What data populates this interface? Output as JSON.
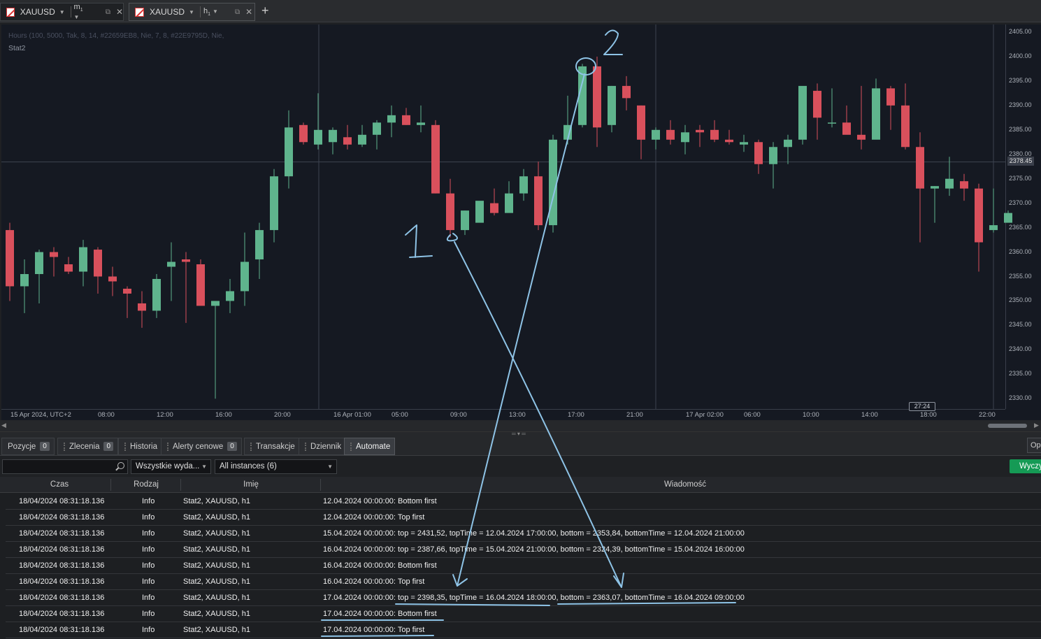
{
  "tabs": [
    {
      "symbol": "XAUUSD",
      "timeframe": "m",
      "timeframe_sub": "1"
    },
    {
      "symbol": "XAUUSD",
      "timeframe": "h",
      "timeframe_sub": "1"
    }
  ],
  "chart": {
    "indicator_params": "Hours (100, 5000, Tak, 8, 14, #22659EB8, Nie, 7, 8, #22E9795D, Nie,",
    "strategy_name": "Stat2",
    "current_price": "2378.45",
    "bar_timer": "27:24",
    "y_ticks": [
      "2405.00",
      "2400.00",
      "2395.00",
      "2390.00",
      "2385.00",
      "2380.00",
      "2375.00",
      "2370.00",
      "2365.00",
      "2360.00",
      "2355.00",
      "2350.00",
      "2345.00",
      "2340.00",
      "2335.00",
      "2330.00"
    ],
    "x_ticks": [
      "15 Apr 2024, UTC+2",
      "08:00",
      "12:00",
      "16:00",
      "20:00",
      "16 Apr 01:00",
      "05:00",
      "09:00",
      "13:00",
      "17:00",
      "21:00",
      "17 Apr 02:00",
      "06:00",
      "10:00",
      "14:00",
      "18:00",
      "22:00"
    ],
    "up_color": "#5fb48d",
    "down_color": "#d9505c",
    "annotation_color": "#8ec3e6",
    "annotation_labels": [
      "1",
      "2"
    ]
  },
  "chart_data": {
    "type": "candlestick",
    "symbol": "XAUUSD",
    "timeframe": "h1",
    "ylim": [
      2328,
      2406
    ],
    "candles": [
      [
        2364.5,
        2366.0,
        2350.0,
        2353.0
      ],
      [
        2353.0,
        2358.5,
        2347.5,
        2355.5
      ],
      [
        2355.5,
        2360.5,
        2349.5,
        2360.0
      ],
      [
        2360.0,
        2361.0,
        2355.0,
        2359.0
      ],
      [
        2357.5,
        2359.0,
        2355.5,
        2356.0
      ],
      [
        2356.0,
        2362.5,
        2353.0,
        2361.0
      ],
      [
        2360.5,
        2361.0,
        2351.5,
        2355.0
      ],
      [
        2355.0,
        2357.0,
        2351.0,
        2354.0
      ],
      [
        2352.5,
        2353.0,
        2346.5,
        2351.5
      ],
      [
        2349.5,
        2352.0,
        2344.5,
        2348.0
      ],
      [
        2348.0,
        2355.5,
        2346.5,
        2354.5
      ],
      [
        2357.0,
        2362.0,
        2350.0,
        2358.0
      ],
      [
        2358.5,
        2360.0,
        2345.5,
        2358.0
      ],
      [
        2357.5,
        2358.5,
        2350.5,
        2349.0
      ],
      [
        2349.0,
        2350.0,
        2330.0,
        2350.0
      ],
      [
        2350.0,
        2354.5,
        2347.5,
        2352.0
      ],
      [
        2352.0,
        2364.0,
        2349.0,
        2358.0
      ],
      [
        2358.5,
        2366.0,
        2354.5,
        2364.5
      ],
      [
        2364.5,
        2377.0,
        2362.0,
        2375.5
      ],
      [
        2375.5,
        2389.0,
        2373.0,
        2385.5
      ],
      [
        2386.0,
        2386.5,
        2382.0,
        2382.5
      ],
      [
        2382.0,
        2392.5,
        2381.0,
        2385.0
      ],
      [
        2382.5,
        2385.5,
        2380.0,
        2385.0
      ],
      [
        2383.5,
        2386.0,
        2381.0,
        2382.0
      ],
      [
        2382.0,
        2386.0,
        2381.5,
        2384.0
      ],
      [
        2384.0,
        2387.0,
        2381.0,
        2386.5
      ],
      [
        2386.5,
        2390.0,
        2383.5,
        2388.0
      ],
      [
        2388.0,
        2389.5,
        2386.0,
        2386.0
      ],
      [
        2386.0,
        2390.0,
        2384.5,
        2386.5
      ],
      [
        2386.0,
        2387.0,
        2372.0,
        2372.0
      ],
      [
        2372.0,
        2375.0,
        2363.0,
        2364.5
      ],
      [
        2364.5,
        2368.5,
        2363.5,
        2368.5
      ],
      [
        2366.0,
        2370.0,
        2367.5,
        2370.5
      ],
      [
        2370.0,
        2373.0,
        2367.5,
        2368.0
      ],
      [
        2368.0,
        2374.5,
        2368.5,
        2372.0
      ],
      [
        2372.0,
        2377.0,
        2370.5,
        2375.5
      ],
      [
        2375.5,
        2378.5,
        2364.5,
        2365.5
      ],
      [
        2365.5,
        2384.0,
        2364.0,
        2383.0
      ],
      [
        2383.0,
        2392.0,
        2382.0,
        2386.0
      ],
      [
        2386.0,
        2398.5,
        2385.5,
        2398.0
      ],
      [
        2398.0,
        2400.0,
        2381.5,
        2385.5
      ],
      [
        2386.0,
        2394.0,
        2384.5,
        2394.0
      ],
      [
        2394.0,
        2396.0,
        2389.0,
        2391.5
      ],
      [
        2390.0,
        2390.0,
        2379.0,
        2383.0
      ],
      [
        2383.0,
        2385.5,
        2381.0,
        2385.0
      ],
      [
        2385.0,
        2387.0,
        2382.0,
        2383.0
      ],
      [
        2382.5,
        2386.0,
        2380.0,
        2384.5
      ],
      [
        2385.0,
        2386.0,
        2381.5,
        2384.5
      ],
      [
        2385.0,
        2387.0,
        2382.5,
        2383.0
      ],
      [
        2383.0,
        2385.0,
        2382.0,
        2382.5
      ],
      [
        2382.0,
        2384.0,
        2380.5,
        2382.5
      ],
      [
        2382.5,
        2383.0,
        2376.0,
        2378.0
      ],
      [
        2378.0,
        2382.5,
        2373.0,
        2381.5
      ],
      [
        2381.5,
        2384.0,
        2378.0,
        2383.0
      ],
      [
        2383.0,
        2393.5,
        2382.0,
        2394.0
      ],
      [
        2393.0,
        2394.5,
        2383.0,
        2387.5
      ],
      [
        2386.5,
        2393.5,
        2385.5,
        2386.5
      ],
      [
        2386.5,
        2390.0,
        2385.0,
        2384.0
      ],
      [
        2384.0,
        2394.0,
        2381.0,
        2383.0
      ],
      [
        2383.0,
        2395.5,
        2383.5,
        2393.5
      ],
      [
        2393.5,
        2394.0,
        2385.0,
        2390.0
      ],
      [
        2390.0,
        2394.5,
        2381.0,
        2381.5
      ],
      [
        2381.5,
        2384.5,
        2362.0,
        2373.0
      ],
      [
        2373.0,
        2373.5,
        2366.0,
        2373.5
      ],
      [
        2373.0,
        2379.5,
        2371.5,
        2375.0
      ],
      [
        2374.5,
        2376.0,
        2370.5,
        2373.0
      ],
      [
        2373.0,
        2374.0,
        2356.0,
        2362.0
      ],
      [
        2364.5,
        2373.0,
        2364.0,
        2365.5
      ],
      [
        2366.0,
        2368.5,
        2367.0,
        2368.0
      ]
    ]
  },
  "panel": {
    "tabs": [
      {
        "label": "Pozycje",
        "badge": "0"
      },
      {
        "label": "Zlecenia",
        "badge": "0"
      },
      {
        "label": "Historia"
      },
      {
        "label": "Alerty cenowe",
        "badge": "0"
      },
      {
        "label": "Transakcje"
      },
      {
        "label": "Dziennik"
      },
      {
        "label": "Automate"
      }
    ],
    "options_label": "Op",
    "search_placeholder": "",
    "filter_events": "Wszystkie wyda...",
    "filter_instances": "All instances (6)",
    "clear_button": "Wyczy",
    "columns": [
      "Czas",
      "Rodzaj",
      "Imię",
      "Wiadomość"
    ],
    "rows": [
      {
        "time": "18/04/2024 08:31:18.136",
        "kind": "Info",
        "name": "Stat2, XAUUSD, h1",
        "message": "12.04.2024 00:00:00: Bottom first"
      },
      {
        "time": "18/04/2024 08:31:18.136",
        "kind": "Info",
        "name": "Stat2, XAUUSD, h1",
        "message": "12.04.2024 00:00:00: Top first"
      },
      {
        "time": "18/04/2024 08:31:18.136",
        "kind": "Info",
        "name": "Stat2, XAUUSD, h1",
        "message": "15.04.2024 00:00:00: top = 2431,52, topTime = 12.04.2024 17:00:00, bottom = 2353,84, bottomTime = 12.04.2024 21:00:00"
      },
      {
        "time": "18/04/2024 08:31:18.136",
        "kind": "Info",
        "name": "Stat2, XAUUSD, h1",
        "message": "16.04.2024 00:00:00: top = 2387,66, topTime = 15.04.2024 21:00:00, bottom = 2324,39, bottomTime = 15.04.2024 16:00:00"
      },
      {
        "time": "18/04/2024 08:31:18.136",
        "kind": "Info",
        "name": "Stat2, XAUUSD, h1",
        "message": "16.04.2024 00:00:00: Bottom first"
      },
      {
        "time": "18/04/2024 08:31:18.136",
        "kind": "Info",
        "name": "Stat2, XAUUSD, h1",
        "message": "16.04.2024 00:00:00: Top first"
      },
      {
        "time": "18/04/2024 08:31:18.136",
        "kind": "Info",
        "name": "Stat2, XAUUSD, h1",
        "message": "17.04.2024 00:00:00: top = 2398,35, topTime = 16.04.2024 18:00:00, bottom = 2363,07, bottomTime = 16.04.2024 09:00:00"
      },
      {
        "time": "18/04/2024 08:31:18.136",
        "kind": "Info",
        "name": "Stat2, XAUUSD, h1",
        "message": "17.04.2024 00:00:00: Bottom first"
      },
      {
        "time": "18/04/2024 08:31:18.136",
        "kind": "Info",
        "name": "Stat2, XAUUSD, h1",
        "message": "17.04.2024 00:00:00: Top first"
      }
    ]
  }
}
